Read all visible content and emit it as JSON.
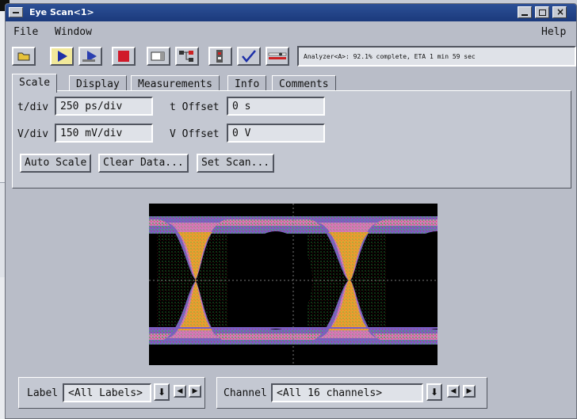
{
  "window": {
    "title": "Eye Scan<1>"
  },
  "menu": {
    "file": "File",
    "window": "Window",
    "help": "Help"
  },
  "toolbar": {
    "buttons": [
      "folder-icon",
      "run-icon",
      "run-repetitive-icon",
      "stop-icon",
      "display-icon",
      "hierarchy-icon",
      "module-icon",
      "check-icon",
      "settings-icon"
    ],
    "status": "Analyzer<A>:  92.1% complete, ETA 1 min 59 sec"
  },
  "tabs": [
    "Scale",
    "Display",
    "Measurements",
    "Info",
    "Comments"
  ],
  "scale": {
    "tdiv_label": "t/div",
    "tdiv_value": "250 ps/div",
    "toffset_label": "t Offset",
    "toffset_value": "0 s",
    "vdiv_label": "V/div",
    "vdiv_value": "150 mV/div",
    "voffset_label": "V Offset",
    "voffset_value": "0 V",
    "auto_scale": "Auto Scale",
    "clear_data": "Clear Data...",
    "set_scan": "Set Scan..."
  },
  "bottom": {
    "label_label": "Label",
    "label_value": "<All Labels>",
    "channel_label": "Channel",
    "channel_value": "<All 16 channels>"
  },
  "colors": {
    "titlebar": "#1b3a7c",
    "active_button": "#f1e89a",
    "stop": "#d01a2a",
    "eye_outer": "#7a5fc4",
    "eye_pink": "#d47ab8",
    "eye_orange": "#e8a030",
    "eye_green": "#3fae4a",
    "eye_red": "#e0202a"
  }
}
